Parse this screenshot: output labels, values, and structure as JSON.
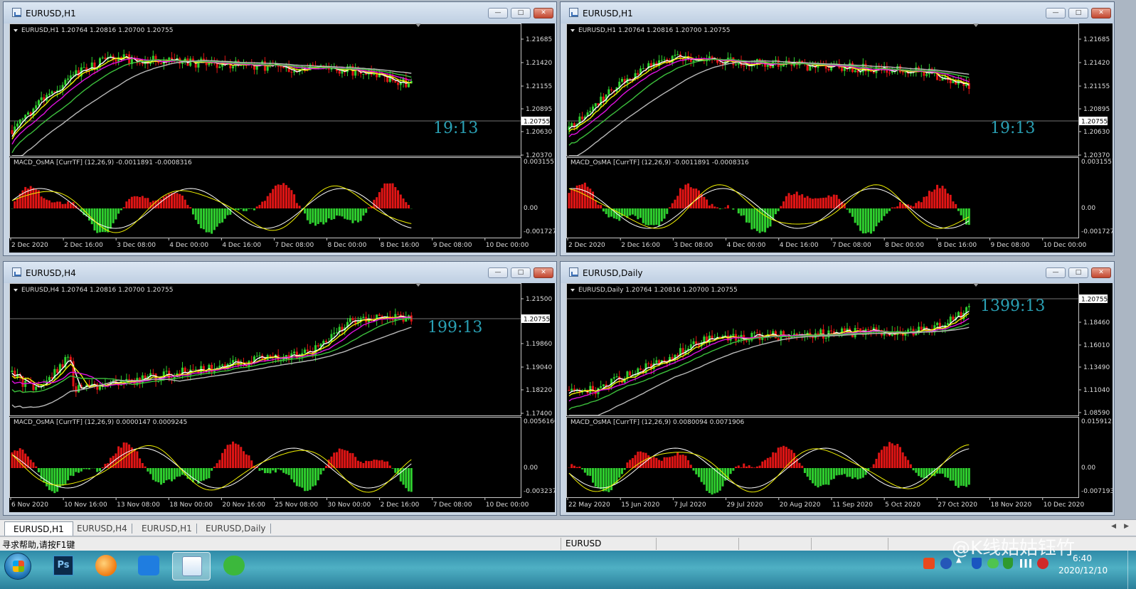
{
  "charts": [
    {
      "title": "EURUSD,H1",
      "info": "EURUSD,H1  1.20764 1.20816 1.20700 1.20755",
      "timer": "19:13",
      "current_price": "1.20755",
      "price_ticks": [
        "1.21685",
        "1.21420",
        "1.21155",
        "1.20895",
        "1.20630",
        "1.20370"
      ],
      "macd_label": "MACD_OsMA [CurrTF] (12,26,9) -0.0011891 -0.0008316",
      "macd_ticks": [
        "0.0031557",
        "0.00",
        "-0.001727"
      ],
      "time_ticks": [
        "2 Dec 2020",
        "2 Dec 16:00",
        "3 Dec 08:00",
        "4 Dec 00:00",
        "4 Dec 16:00",
        "7 Dec 08:00",
        "8 Dec 00:00",
        "8 Dec 16:00",
        "9 Dec 08:00",
        "10 Dec 00:00"
      ]
    },
    {
      "title": "EURUSD,H1",
      "info": "EURUSD,H1  1.20764 1.20816 1.20700 1.20755",
      "timer": "19:13",
      "current_price": "1.20755",
      "price_ticks": [
        "1.21685",
        "1.21420",
        "1.21155",
        "1.20895",
        "1.20630",
        "1.20370"
      ],
      "macd_label": "MACD_OsMA [CurrTF] (12,26,9) -0.0011891 -0.0008316",
      "macd_ticks": [
        "0.0031557",
        "0.00",
        "-0.001727"
      ],
      "time_ticks": [
        "2 Dec 2020",
        "2 Dec 16:00",
        "3 Dec 08:00",
        "4 Dec 00:00",
        "4 Dec 16:00",
        "7 Dec 08:00",
        "8 Dec 00:00",
        "8 Dec 16:00",
        "9 Dec 08:00",
        "10 Dec 00:00"
      ]
    },
    {
      "title": "EURUSD,H4",
      "info": "EURUSD,H4  1.20764 1.20816 1.20700 1.20755",
      "timer": "199:13",
      "current_price": "1.20755",
      "price_ticks": [
        "1.21500",
        "1.19860",
        "1.19040",
        "1.18220",
        "1.17400"
      ],
      "macd_label": "MACD_OsMA [CurrTF] (12,26,9) 0.0000147 0.0009245",
      "macd_ticks": [
        "0.0056166",
        "0.00",
        "-0.003237"
      ],
      "time_ticks": [
        "6 Nov 2020",
        "10 Nov 16:00",
        "13 Nov 08:00",
        "18 Nov 00:00",
        "20 Nov 16:00",
        "25 Nov 08:00",
        "30 Nov 00:00",
        "2 Dec 16:00",
        "7 Dec 08:00",
        "10 Dec 00:00"
      ]
    },
    {
      "title": "EURUSD,Daily",
      "info": "EURUSD,Daily  1.20764 1.20816 1.20700 1.20755",
      "timer": "1399:13",
      "current_price": "1.20755",
      "price_ticks": [
        "1.18460",
        "1.16010",
        "1.13490",
        "1.11040",
        "1.08590"
      ],
      "macd_label": "MACD_OsMA [CurrTF] (12,26,9) 0.0080094 0.0071906",
      "macd_ticks": [
        "0.0159123",
        "0.00",
        "-0.0071931"
      ],
      "time_ticks": [
        "22 May 2020",
        "15 Jun 2020",
        "7 Jul 2020",
        "29 Jul 2020",
        "20 Aug 2020",
        "11 Sep 2020",
        "5 Oct 2020",
        "27 Oct 2020",
        "18 Nov 2020",
        "10 Dec 2020"
      ]
    }
  ],
  "window_buttons": {
    "minimize": "—",
    "maximize": "□",
    "close": "✕"
  },
  "tabs": [
    "EURUSD,H1",
    "EURUSD,H4",
    "EURUSD,H1",
    "EURUSD,Daily"
  ],
  "status": {
    "help": "寻求帮助,请按F1键",
    "symbol": "EURUSD"
  },
  "taskbar": {
    "watermark": "@K线姑姑钰竹",
    "time": "6:40",
    "date": "2020/12/10",
    "ps_label": "Ps"
  },
  "colors": {
    "bull": "#2fd02f",
    "bear": "#e21515",
    "ma_white": "#ffffff",
    "ma_yellow": "#f0f000",
    "ma_magenta": "#e010e0",
    "ma_green": "#3cc03c",
    "ma_gray": "#b8b8b8",
    "timer": "#2aa0b4"
  }
}
